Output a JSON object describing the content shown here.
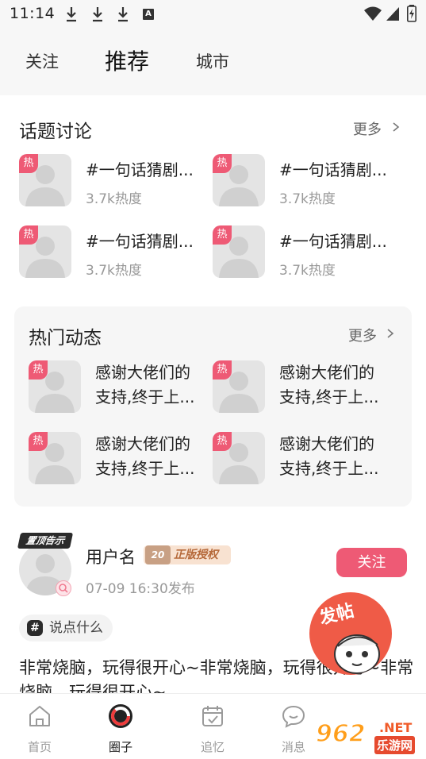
{
  "status_bar": {
    "time": "11:14",
    "badge_letter": "A"
  },
  "top_tabs": {
    "follow": "关注",
    "recommend": "推荐",
    "city": "城市"
  },
  "topics": {
    "title": "话题讨论",
    "more": "更多",
    "items": [
      {
        "badge": "热",
        "title": "#一句话猜剧...",
        "heat": "3.7k热度"
      },
      {
        "badge": "热",
        "title": "#一句话猜剧...",
        "heat": "3.7k热度"
      },
      {
        "badge": "热",
        "title": "#一句话猜剧...",
        "heat": "3.7k热度"
      },
      {
        "badge": "热",
        "title": "#一句话猜剧...",
        "heat": "3.7k热度"
      }
    ]
  },
  "hot_feed": {
    "title": "热门动态",
    "more": "更多",
    "items": [
      {
        "badge": "热",
        "line1": "感谢大佬们的",
        "line2": "支持,终于上..."
      },
      {
        "badge": "热",
        "line1": "感谢大佬们的",
        "line2": "支持,终于上..."
      },
      {
        "badge": "热",
        "line1": "感谢大佬们的",
        "line2": "支持,终于上..."
      },
      {
        "badge": "热",
        "line1": "感谢大佬们的",
        "line2": "支持,终于上..."
      }
    ]
  },
  "post": {
    "pin_label": "置顶告示",
    "username": "用户名",
    "license_num": "20",
    "license_text": "正版授权",
    "time": "07-09 16:30发布",
    "follow": "关注",
    "tag": "说点什么",
    "tag_icon": "#",
    "body": "非常烧脑，玩得很开心~非常烧脑，玩得很开心~非常烧脑，玩得很开心~"
  },
  "float_sticker": {
    "text": "发帖"
  },
  "bottom_nav": {
    "items": [
      {
        "label": "首页",
        "icon": "home-icon",
        "active": false
      },
      {
        "label": "圈子",
        "icon": "circle-icon",
        "active": true
      },
      {
        "label": "追忆",
        "icon": "calendar-icon",
        "active": false
      },
      {
        "label": "消息",
        "icon": "message-icon",
        "active": false
      }
    ]
  },
  "watermark": {
    "brand": "962",
    "domain": ".NET",
    "site": "乐游网"
  },
  "colors": {
    "accent": "#ee5a75",
    "panel": "#f6f6f6",
    "top_bg": "#f7f7f7"
  }
}
